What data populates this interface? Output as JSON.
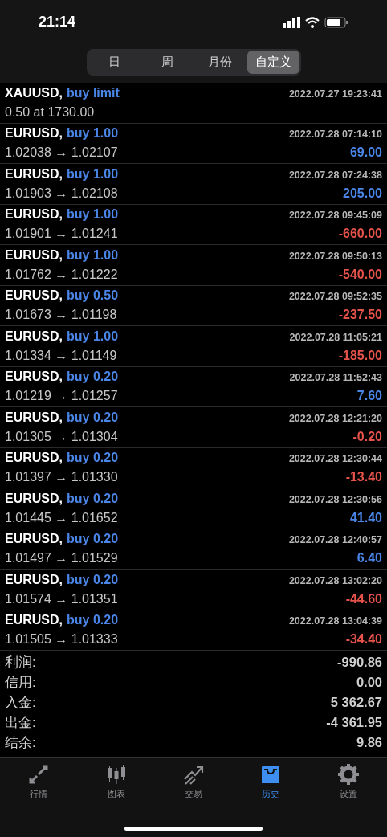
{
  "status_bar": {
    "time": "21:14"
  },
  "tabs": [
    {
      "label": "日",
      "selected": false
    },
    {
      "label": "周",
      "selected": false
    },
    {
      "label": "月份",
      "selected": false
    },
    {
      "label": "自定义",
      "selected": true
    }
  ],
  "deals": [
    {
      "kind": "order",
      "symbol": "XAUUSD,",
      "action": "buy limit",
      "time": "2022.07.27 19:23:41",
      "detail": "0.50 at 1730.00"
    },
    {
      "kind": "deal",
      "symbol": "EURUSD,",
      "action": "buy 1.00",
      "time": "2022.07.28 07:14:10",
      "detail": "1.02038 → 1.02107",
      "profit": "69.00",
      "color": "#4a86e8"
    },
    {
      "kind": "deal",
      "symbol": "EURUSD,",
      "action": "buy 1.00",
      "time": "2022.07.28 07:24:38",
      "detail": "1.01903 → 1.02108",
      "profit": "205.00",
      "color": "#4a86e8"
    },
    {
      "kind": "deal",
      "symbol": "EURUSD,",
      "action": "buy 1.00",
      "time": "2022.07.28 09:45:09",
      "detail": "1.01901 → 1.01241",
      "profit": "-660.00",
      "color": "#e5534b"
    },
    {
      "kind": "deal",
      "symbol": "EURUSD,",
      "action": "buy 1.00",
      "time": "2022.07.28 09:50:13",
      "detail": "1.01762 → 1.01222",
      "profit": "-540.00",
      "color": "#e5534b"
    },
    {
      "kind": "deal",
      "symbol": "EURUSD,",
      "action": "buy 0.50",
      "time": "2022.07.28 09:52:35",
      "detail": "1.01673 → 1.01198",
      "profit": "-237.50",
      "color": "#e5534b"
    },
    {
      "kind": "deal",
      "symbol": "EURUSD,",
      "action": "buy 1.00",
      "time": "2022.07.28 11:05:21",
      "detail": "1.01334 → 1.01149",
      "profit": "-185.00",
      "color": "#e5534b"
    },
    {
      "kind": "deal",
      "symbol": "EURUSD,",
      "action": "buy 0.20",
      "time": "2022.07.28 11:52:43",
      "detail": "1.01219 → 1.01257",
      "profit": "7.60",
      "color": "#4a86e8"
    },
    {
      "kind": "deal",
      "symbol": "EURUSD,",
      "action": "buy 0.20",
      "time": "2022.07.28 12:21:20",
      "detail": "1.01305 → 1.01304",
      "profit": "-0.20",
      "color": "#e5534b"
    },
    {
      "kind": "deal",
      "symbol": "EURUSD,",
      "action": "buy 0.20",
      "time": "2022.07.28 12:30:44",
      "detail": "1.01397 → 1.01330",
      "profit": "-13.40",
      "color": "#e5534b"
    },
    {
      "kind": "deal",
      "symbol": "EURUSD,",
      "action": "buy 0.20",
      "time": "2022.07.28 12:30:56",
      "detail": "1.01445 → 1.01652",
      "profit": "41.40",
      "color": "#4a86e8"
    },
    {
      "kind": "deal",
      "symbol": "EURUSD,",
      "action": "buy 0.20",
      "time": "2022.07.28 12:40:57",
      "detail": "1.01497 → 1.01529",
      "profit": "6.40",
      "color": "#4a86e8"
    },
    {
      "kind": "deal",
      "symbol": "EURUSD,",
      "action": "buy 0.20",
      "time": "2022.07.28 13:02:20",
      "detail": "1.01574 → 1.01351",
      "profit": "-44.60",
      "color": "#e5534b"
    },
    {
      "kind": "deal",
      "symbol": "EURUSD,",
      "action": "buy 0.20",
      "time": "2022.07.28 13:04:39",
      "detail": "1.01505 → 1.01333",
      "profit": "-34.40",
      "color": "#e5534b"
    }
  ],
  "summary": [
    {
      "label": "利润:",
      "value": "-990.86"
    },
    {
      "label": "信用:",
      "value": "0.00"
    },
    {
      "label": "入金:",
      "value": "5 362.67"
    },
    {
      "label": "出金:",
      "value": "-4 361.95"
    },
    {
      "label": "结余:",
      "value": "9.86"
    }
  ],
  "tab_bar": [
    {
      "kind": "quotes",
      "label": "行情",
      "selected": false
    },
    {
      "kind": "chart",
      "label": "图表",
      "selected": false
    },
    {
      "kind": "trade",
      "label": "交易",
      "selected": false
    },
    {
      "kind": "history",
      "label": "历史",
      "selected": true
    },
    {
      "kind": "settings",
      "label": "设置",
      "selected": false
    }
  ]
}
